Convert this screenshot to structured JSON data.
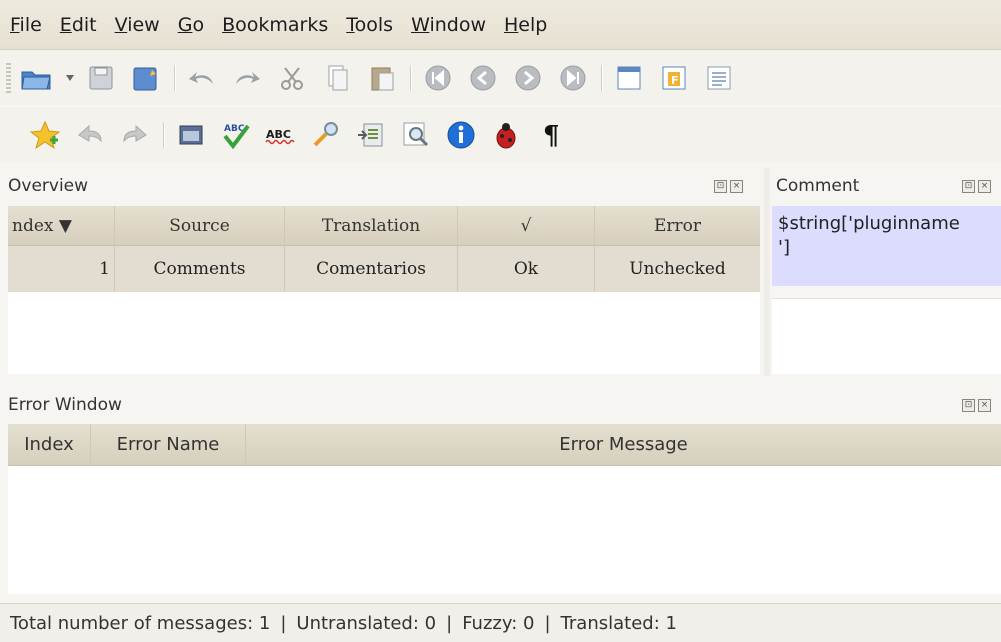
{
  "menu": [
    {
      "mn": "F",
      "rest": "ile"
    },
    {
      "mn": "E",
      "rest": "dit"
    },
    {
      "mn": "V",
      "rest": "iew"
    },
    {
      "mn": "G",
      "rest": "o"
    },
    {
      "mn": "B",
      "rest": "ookmarks"
    },
    {
      "mn": "T",
      "rest": "ools"
    },
    {
      "mn": "W",
      "rest": "indow"
    },
    {
      "mn": "H",
      "rest": "elp"
    }
  ],
  "overview": {
    "title": "Overview",
    "columns": {
      "index": "ndex ▼",
      "source": "Source",
      "translation": "Translation",
      "check": "√",
      "error": "Error"
    },
    "rows": [
      {
        "index": "1",
        "source": "Comments",
        "translation": "Comentarios",
        "check": "Ok",
        "error": "Unchecked"
      }
    ]
  },
  "comment": {
    "title": "Comment",
    "text": "$string['pluginname\n']"
  },
  "error_window": {
    "title": "Error Window",
    "columns": {
      "index": "Index",
      "name": "Error Name",
      "message": "Error Message"
    }
  },
  "status": {
    "total_label": "Total number of messages:",
    "total": "1",
    "untranslated_label": "Untranslated:",
    "untranslated": "0",
    "fuzzy_label": "Fuzzy:",
    "fuzzy": "0",
    "translated_label": "Translated:",
    "translated": "1",
    "separator": "|"
  },
  "dock_buttons": {
    "float": "⊡",
    "close": "×"
  },
  "colors": {
    "comment_bg": "#dcdcff",
    "header_bg": "#d6cfbd",
    "row_bg": "#e2ddd0"
  }
}
